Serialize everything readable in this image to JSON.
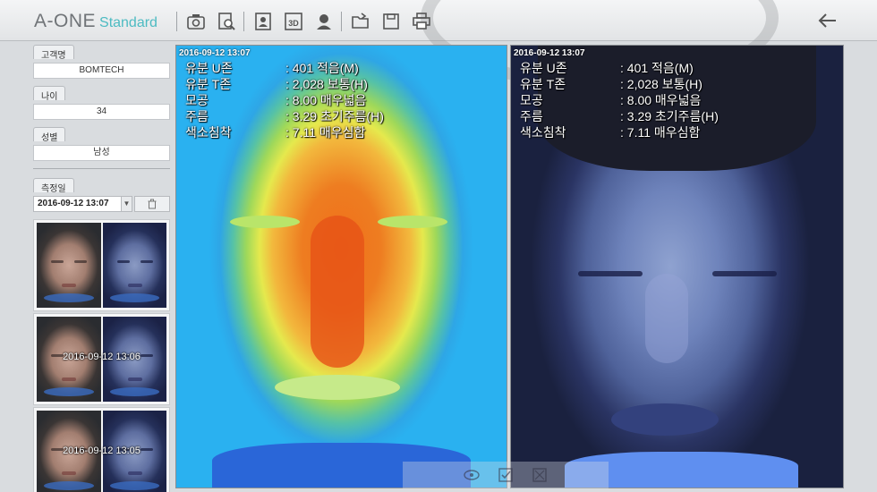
{
  "header": {
    "logo_main": "A-ONE",
    "logo_sub": "Standard",
    "toolbar": [
      "camera-icon",
      "search-document-icon",
      "face-id-icon",
      "3d-icon",
      "profile-icon",
      "folder-open-icon",
      "save-icon",
      "print-icon"
    ],
    "back": "back-arrow-icon"
  },
  "customer": {
    "name_label": "고객명",
    "name_value": "BOMTECH",
    "age_label": "나이",
    "age_value": "34",
    "gender_label": "성별",
    "gender_value": "남성",
    "date_label": "측정일",
    "date_value": "2016-09-12 13:07"
  },
  "thumbnails": [
    {
      "label": ""
    },
    {
      "label": "2016-09-12 13:06"
    },
    {
      "label": "2016-09-12 13:05"
    }
  ],
  "left_image": {
    "timestamp": "2016-09-12 13:07",
    "metrics": [
      {
        "name": "유분 U존",
        "value": ": 401 적음(M)"
      },
      {
        "name": "유분 T존",
        "value": ": 2,028 보통(H)"
      },
      {
        "name": "모공",
        "value": ": 8.00 매우넓음"
      },
      {
        "name": "주름",
        "value": ": 3.29 초기주름(H)"
      },
      {
        "name": "색소침착",
        "value": ": 7.11 매우심함"
      }
    ]
  },
  "right_image": {
    "timestamp": "2016-09-12 13:07",
    "metrics": [
      {
        "name": "유분 U존",
        "value": ": 401 적음(M)"
      },
      {
        "name": "유분 T존",
        "value": ": 2,028 보통(H)"
      },
      {
        "name": "모공",
        "value": ": 8.00 매우넓음"
      },
      {
        "name": "주름",
        "value": ": 3.29 초기주름(H)"
      },
      {
        "name": "색소침착",
        "value": ": 7.11 매우심함"
      }
    ]
  },
  "bottom_tools": [
    "compare-icon",
    "edit-check-icon",
    "fullscreen-icon"
  ]
}
